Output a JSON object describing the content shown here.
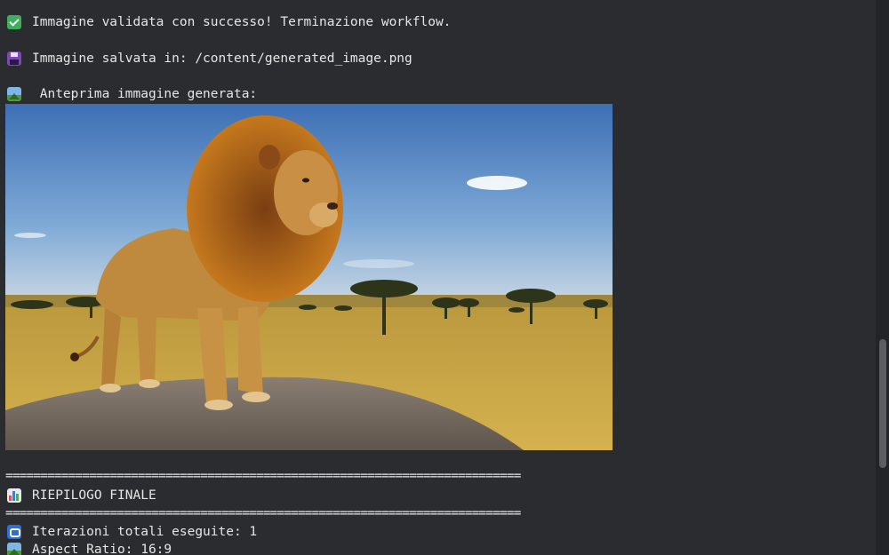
{
  "output": {
    "validated_msg": "Immagine validata con successo! Terminazione workflow.",
    "saved_msg": "Immagine salvata in: /content/generated_image.png",
    "preview_msg": " Anteprima immagine generata:",
    "separator": "==========================================================================",
    "summary_title": "RIEPILOGO FINALE",
    "iterations": "Iterazioni totali eseguite: 1",
    "aspect_ratio": "Aspect Ratio: 16:9"
  },
  "icons": {
    "validated": "check-mark-icon",
    "saved": "floppy-disk-icon",
    "preview": "framed-picture-icon",
    "summary": "bar-chart-icon",
    "iterations": "repeat-icon",
    "aspect_ratio": "framed-picture-icon"
  },
  "colors": {
    "background": "#2b2c2f",
    "text": "#e6e6e6",
    "check": "#3fae5b",
    "floppy": "#7b4bb3",
    "repeat": "#2f6fd6"
  }
}
